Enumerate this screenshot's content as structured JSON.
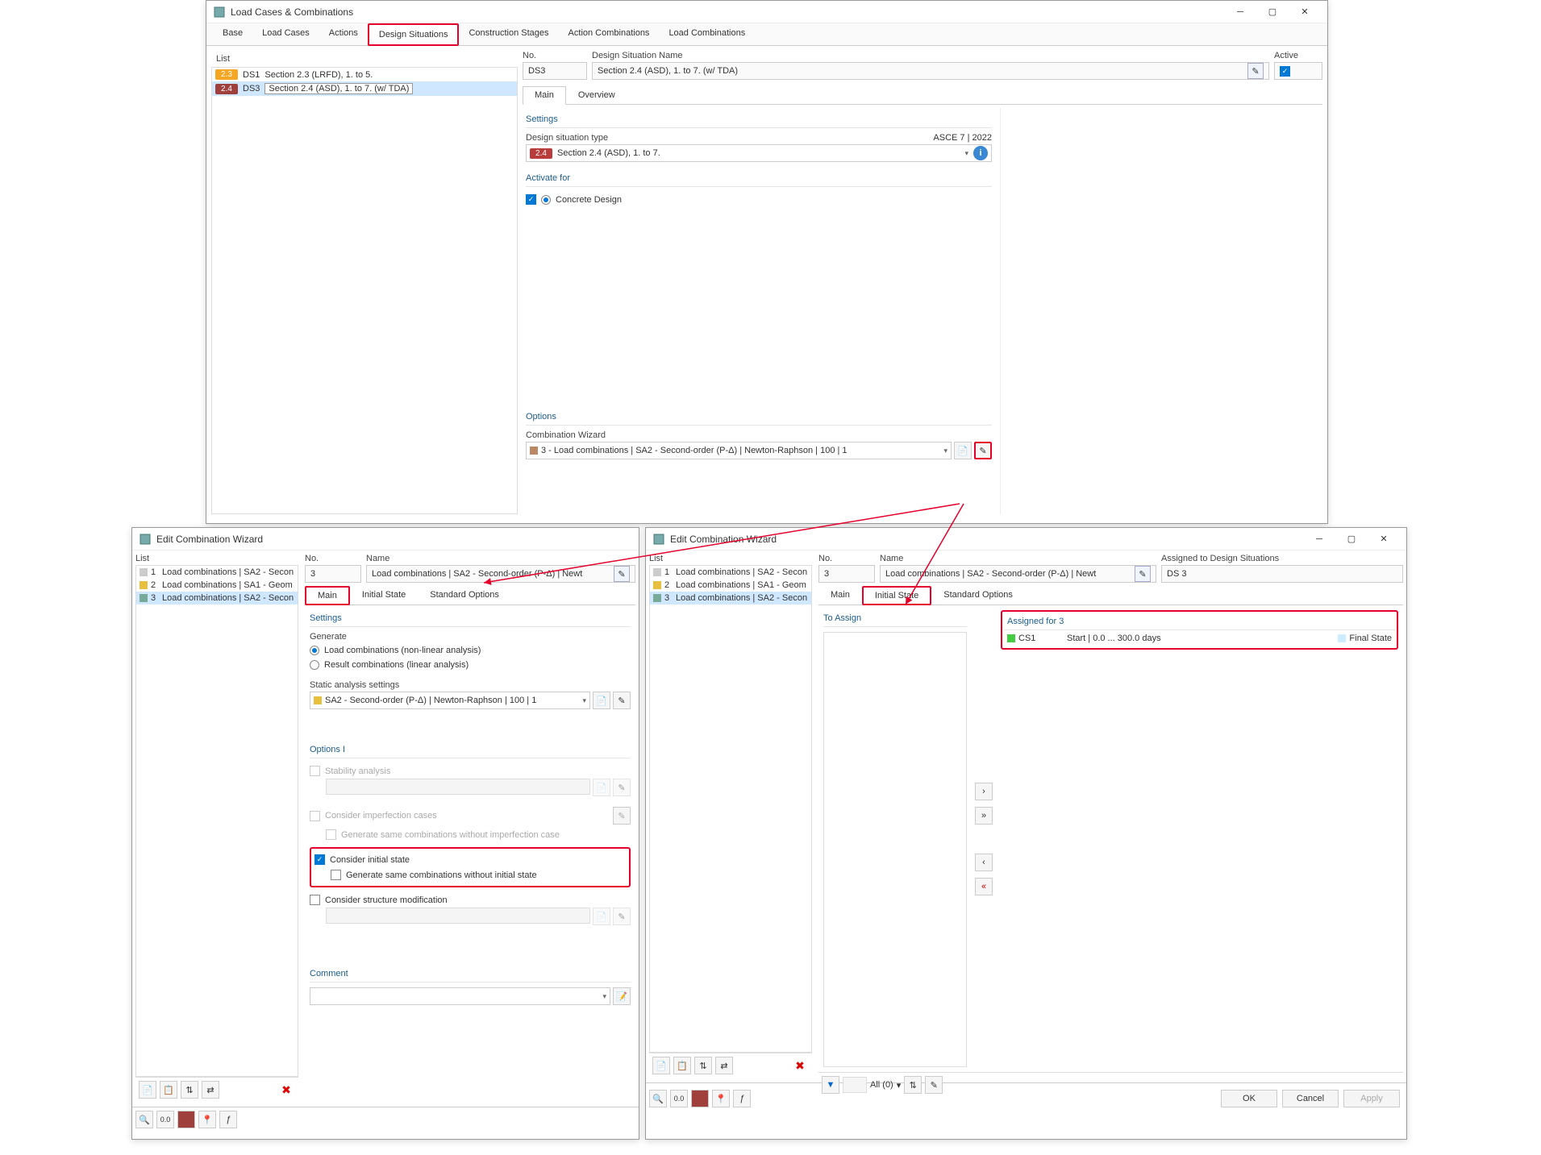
{
  "main_window": {
    "title": "Load Cases & Combinations",
    "tabs": [
      "Base",
      "Load Cases",
      "Actions",
      "Design Situations",
      "Construction Stages",
      "Action Combinations",
      "Load Combinations"
    ],
    "active_tab": 3,
    "list_header": "List",
    "list": [
      {
        "badge": "2.3",
        "id": "DS1",
        "name": "Section 2.3 (LRFD), 1. to 5."
      },
      {
        "badge": "2.4",
        "id": "DS3",
        "name": "Section 2.4 (ASD), 1. to 7. (w/ TDA)"
      }
    ],
    "selected_row": 1,
    "no_label": "No.",
    "no_value": "DS3",
    "name_label": "Design Situation Name",
    "name_value": "Section 2.4 (ASD), 1. to 7. (w/ TDA)",
    "active_label": "Active",
    "inner_tabs": [
      "Main",
      "Overview"
    ],
    "settings_header": "Settings",
    "design_type_label": "Design situation type",
    "design_type_std": "ASCE 7 | 2022",
    "design_type_value": "Section 2.4 (ASD), 1. to 7.",
    "design_type_badge": "2.4",
    "activate_header": "Activate for",
    "activate_item": "Concrete Design",
    "options_header": "Options",
    "combo_wizard_label": "Combination Wizard",
    "combo_wizard_value": "3 - Load combinations | SA2 - Second-order (P-Δ) | Newton-Raphson | 100 | 1"
  },
  "wizard_left": {
    "title": "Edit Combination Wizard",
    "list_header": "List",
    "list": [
      {
        "num": "1",
        "name": "Load combinations | SA2 - Secon"
      },
      {
        "num": "2",
        "name": "Load combinations | SA1 - Geom"
      },
      {
        "num": "3",
        "name": "Load combinations | SA2 - Secon"
      }
    ],
    "no_label": "No.",
    "no_value": "3",
    "name_label": "Name",
    "name_value": "Load combinations | SA2 - Second-order (P-Δ) | Newt",
    "tabs": [
      "Main",
      "Initial State",
      "Standard Options"
    ],
    "active_tab": 0,
    "settings_header": "Settings",
    "generate_header": "Generate",
    "radio1": "Load combinations (non-linear analysis)",
    "radio2": "Result combinations (linear analysis)",
    "static_label": "Static analysis settings",
    "static_value": "SA2 - Second-order (P-Δ) | Newton-Raphson | 100 | 1",
    "options1_header": "Options I",
    "opt_stability": "Stability analysis",
    "opt_imperfection": "Consider imperfection cases",
    "opt_imperfection_sub": "Generate same combinations without imperfection case",
    "opt_initial": "Consider initial state",
    "opt_initial_sub": "Generate same combinations without initial state",
    "opt_structure": "Consider structure modification",
    "comment_header": "Comment"
  },
  "wizard_right": {
    "title": "Edit Combination Wizard",
    "list_header": "List",
    "list": [
      {
        "num": "1",
        "name": "Load combinations | SA2 - Secon"
      },
      {
        "num": "2",
        "name": "Load combinations | SA1 - Geom"
      },
      {
        "num": "3",
        "name": "Load combinations | SA2 - Secon"
      }
    ],
    "no_label": "No.",
    "no_value": "3",
    "name_label": "Name",
    "name_value": "Load combinations | SA2 - Second-order (P-Δ) | Newt",
    "assigned_label": "Assigned to Design Situations",
    "assigned_value": "DS 3",
    "tabs": [
      "Main",
      "Initial State",
      "Standard Options"
    ],
    "active_tab": 1,
    "to_assign_header": "To Assign",
    "assigned_for_header": "Assigned for 3",
    "assigned_item_name": "CS1",
    "assigned_item_range": "Start | 0.0 ... 300.0 days",
    "assigned_item_final": "Final State",
    "filter_text": "All (0)",
    "ok": "OK",
    "cancel": "Cancel",
    "apply": "Apply"
  }
}
